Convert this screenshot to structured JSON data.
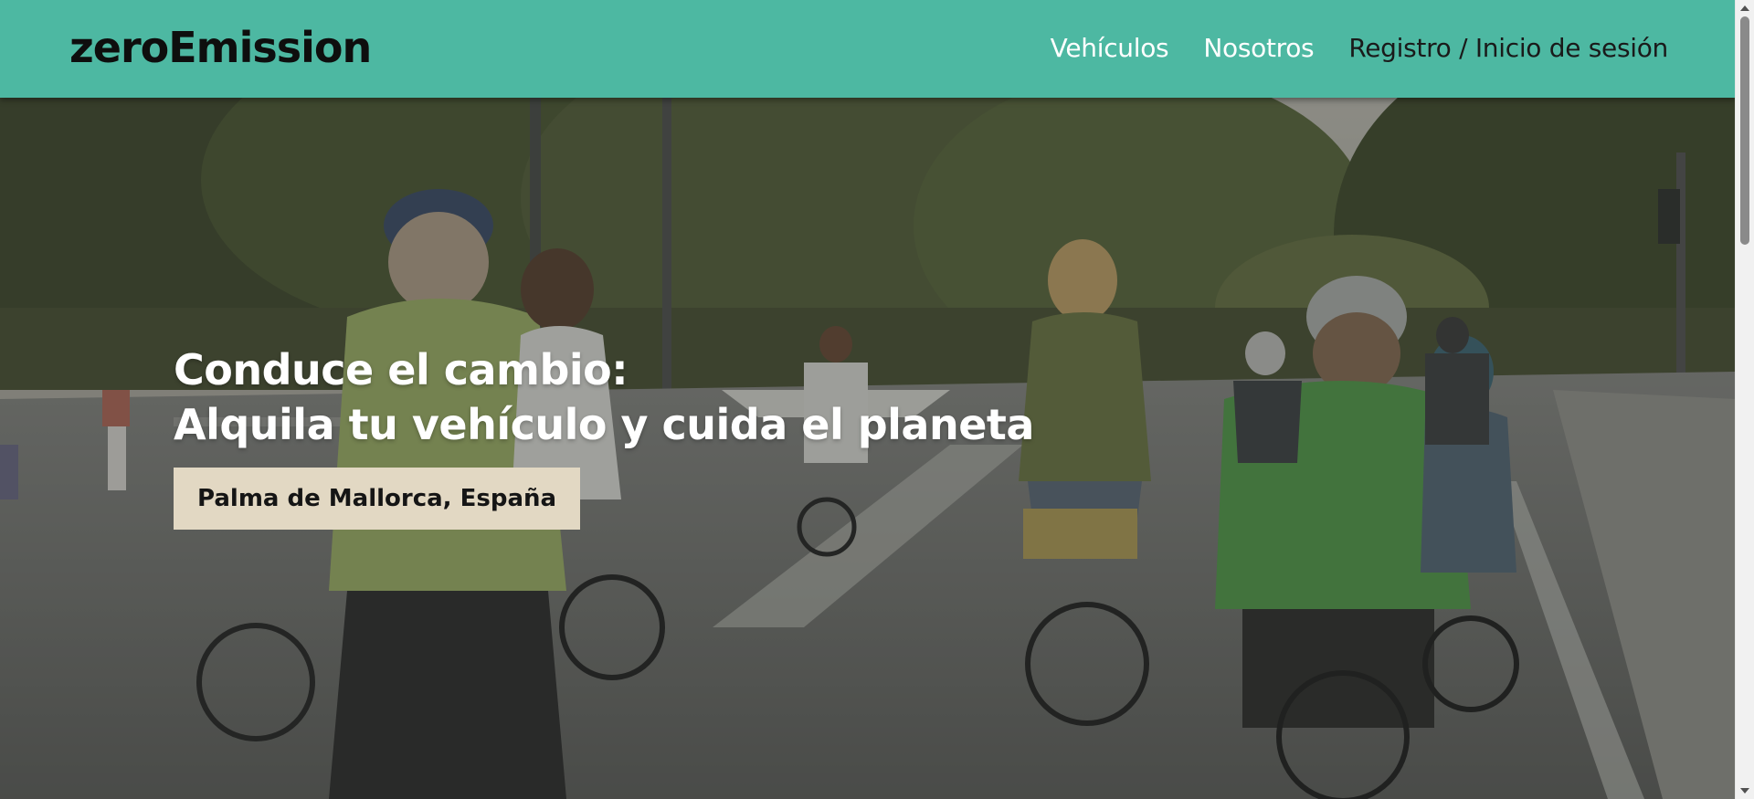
{
  "header": {
    "logo": "zeroEmission",
    "nav": [
      {
        "label": "Vehículos"
      },
      {
        "label": "Nosotros"
      },
      {
        "label": "Registro / Inicio de sesión"
      }
    ]
  },
  "hero": {
    "title_line1": "Conduce el cambio:",
    "title_line2": "Alquila tu vehículo y cuida el planeta",
    "location": "Palma de Mallorca, España",
    "background_image": "cyclists-on-city-street"
  },
  "colors": {
    "header_bg": "#4db8a2",
    "badge_bg": "#e2d8c3",
    "hero_text": "#ffffff"
  },
  "icons": [
    "scrollbar-up-arrow",
    "scrollbar-down-arrow"
  ]
}
